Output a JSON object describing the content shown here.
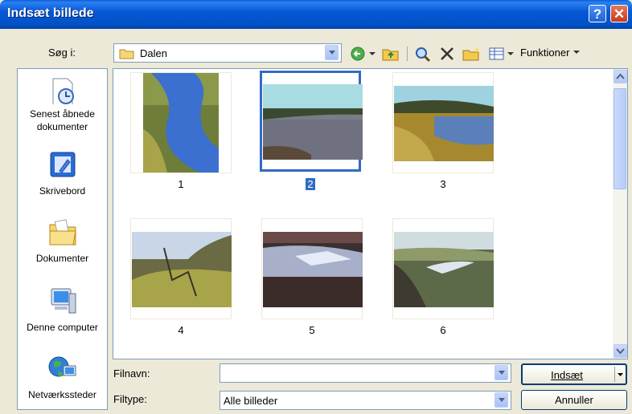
{
  "window": {
    "title": "Indsæt billede"
  },
  "titlebar": {
    "help_glyph": "?",
    "close_glyph": "✕"
  },
  "lookin": {
    "label": "Søg i:",
    "folder": "Dalen"
  },
  "toolbar": {
    "functions_label": "Funktioner"
  },
  "places": [
    {
      "label": "Senest åbnede dokumenter",
      "icon": "recent-documents-icon"
    },
    {
      "label": "Skrivebord",
      "icon": "desktop-icon"
    },
    {
      "label": "Dokumenter",
      "icon": "documents-folder-icon"
    },
    {
      "label": "Denne computer",
      "icon": "computer-icon"
    },
    {
      "label": "Netværkssteder",
      "icon": "network-places-icon"
    }
  ],
  "files": [
    {
      "name": "1",
      "selected": false
    },
    {
      "name": "2",
      "selected": true
    },
    {
      "name": "3",
      "selected": false
    },
    {
      "name": "4",
      "selected": false
    },
    {
      "name": "5",
      "selected": false
    },
    {
      "name": "6",
      "selected": false
    }
  ],
  "filename": {
    "label": "Filnavn:",
    "value": ""
  },
  "filetype": {
    "label": "Filtype:",
    "value": "Alle billeder"
  },
  "buttons": {
    "insert": "Indsæt",
    "cancel": "Annuller"
  },
  "colors": {
    "title_bar": "#0054e3",
    "selection": "#316ac5",
    "dialog_bg": "#ece9d8"
  }
}
